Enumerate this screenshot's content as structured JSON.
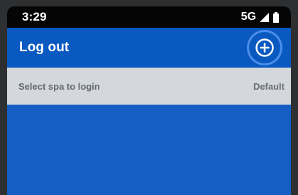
{
  "status_bar": {
    "time": "3:29",
    "network": "5G",
    "icons": [
      "signal-icon",
      "battery-icon"
    ]
  },
  "app_bar": {
    "title": "Log out",
    "action_icon": "add-circle-icon"
  },
  "login_row": {
    "label": "Select spa to login",
    "value": "Default"
  },
  "colors": {
    "app_bar": "#0a59c0",
    "screen_background": "#155fc4",
    "row_background": "#d4d7db",
    "status_bar": "#050505"
  }
}
